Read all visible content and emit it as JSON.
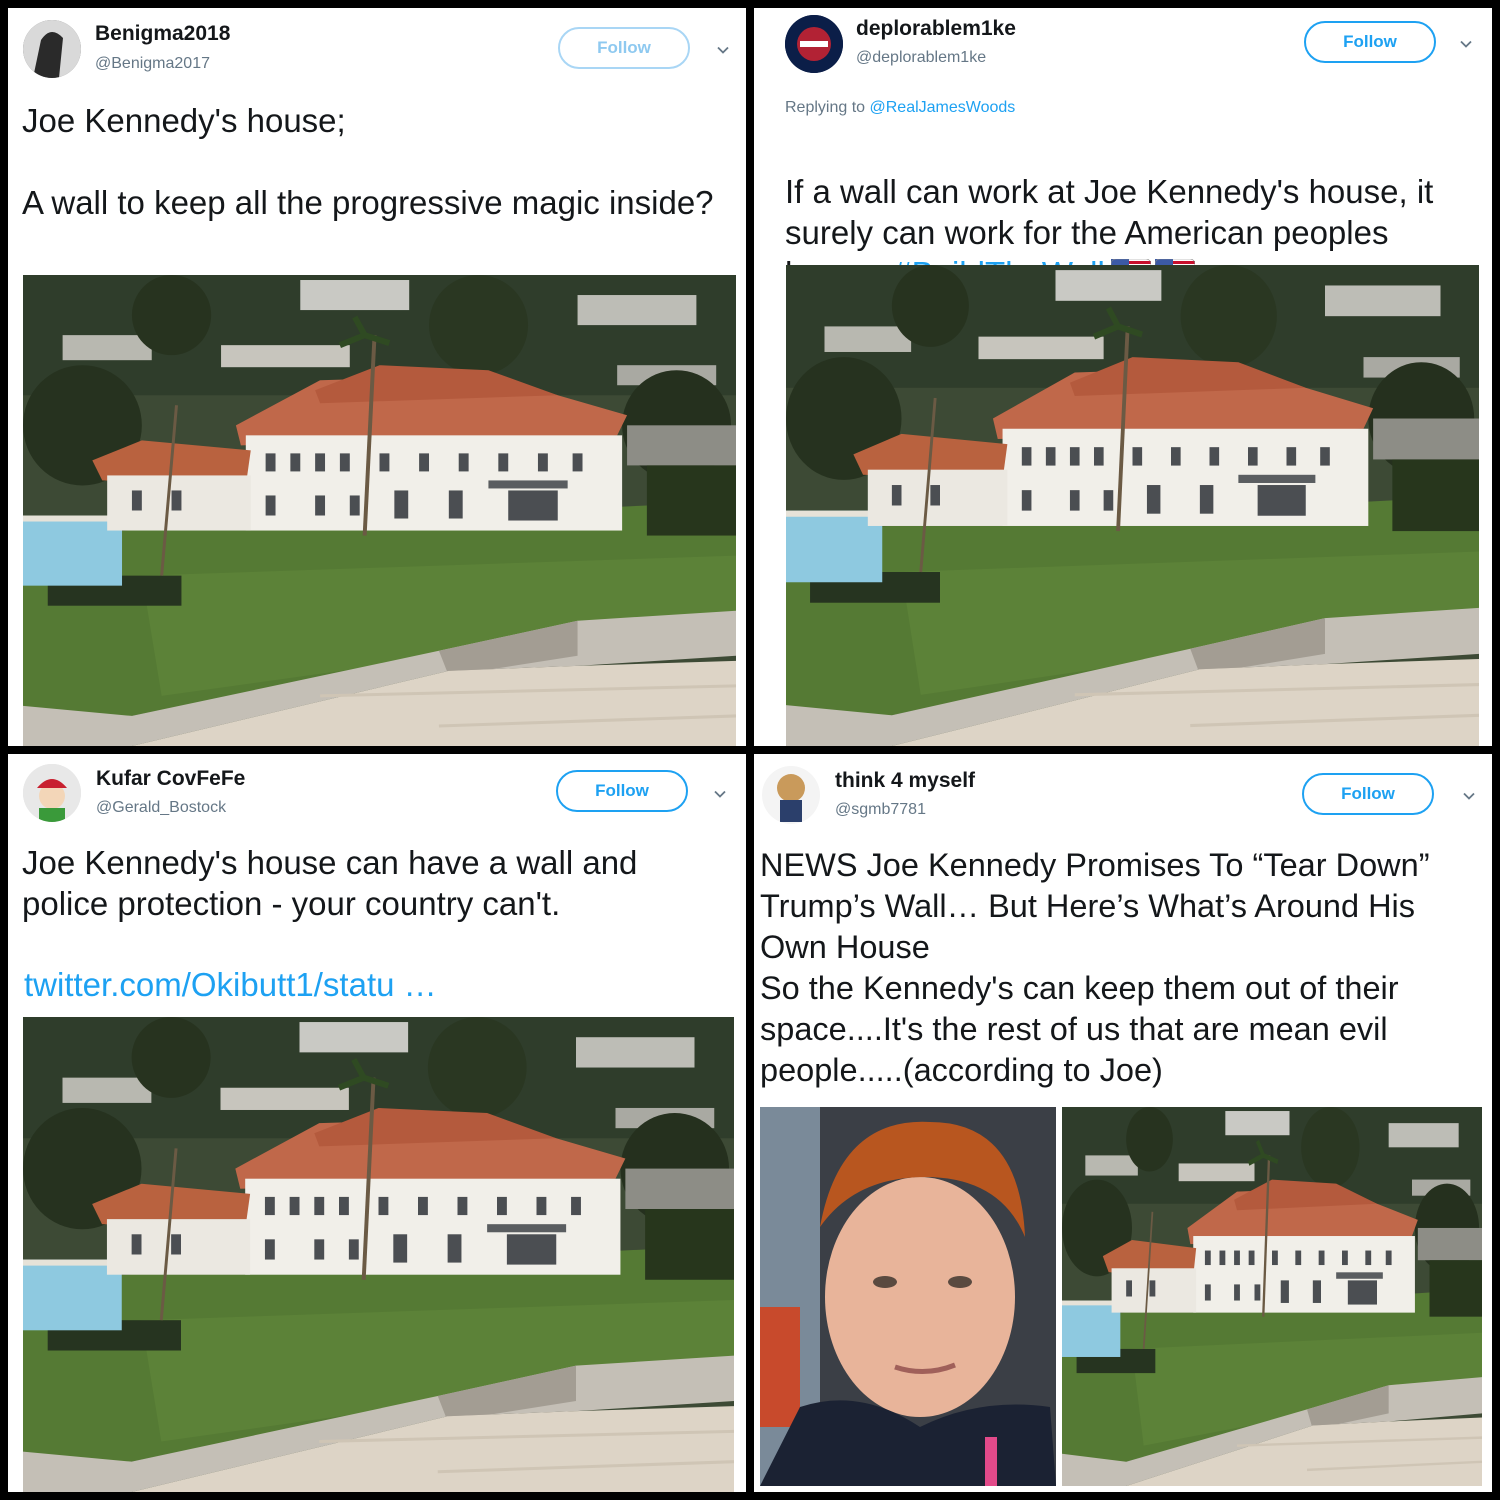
{
  "colors": {
    "accent": "#1da1f2",
    "text": "#14171a",
    "muted": "#657786"
  },
  "tweets": [
    {
      "display_name": "Benigma2018",
      "handle": "@Benigma2017",
      "follow_label": "Follow",
      "text": "Joe Kennedy's house;\n\nA wall to keep all the progressive magic inside?",
      "media": "mansion-photo"
    },
    {
      "display_name": "deplorablem1ke",
      "handle": "@deplorablem1ke",
      "follow_label": "Follow",
      "replying_prefix": "Replying to ",
      "replying_to": "@RealJamesWoods",
      "text": "If a wall can work at Joe Kennedy's house, it surely can work for the American peoples house. ",
      "hashtag": "#BuildTheWall",
      "emoji": [
        "us-flag-icon",
        "us-flag-icon"
      ],
      "media": "mansion-photo"
    },
    {
      "display_name": "Kufar CovFeFe",
      "handle": "@Gerald_Bostock",
      "follow_label": "Follow",
      "text": "Joe Kennedy's house can have a wall and police protection - your country can't.",
      "link": "twitter.com/Okibutt1/statu …",
      "media": "mansion-photo"
    },
    {
      "display_name": "think 4 myself",
      "handle": "@sgmb7781",
      "follow_label": "Follow",
      "text": "NEWS Joe Kennedy Promises To “Tear Down” Trump’s Wall… But Here’s What’s Around His Own House\nSo the Kennedy's can keep them out of their space....It's the rest of us that are mean evil people.....(according to Joe)",
      "media": [
        "portrait-photo",
        "mansion-photo"
      ]
    }
  ]
}
